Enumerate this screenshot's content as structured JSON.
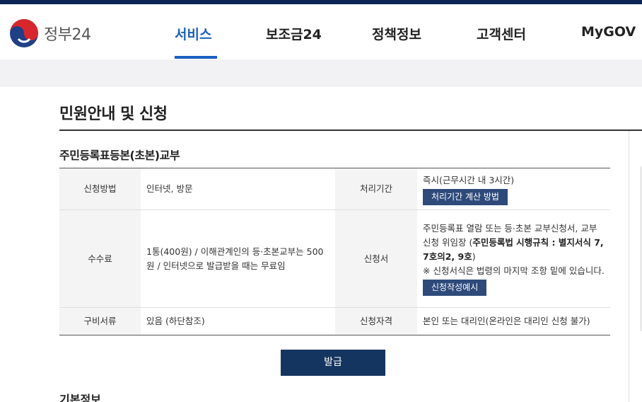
{
  "header": {
    "logo_text": "정부24",
    "nav": [
      "서비스",
      "보조금24",
      "정책정보",
      "고객센터",
      "MyGOV"
    ],
    "active_nav": "서비스"
  },
  "page": {
    "title": "민원안내 및 신청",
    "doc_title": "주민등록표등본(초본)교부",
    "section_next": "기본정보"
  },
  "table": {
    "apply_method_label": "신청방법",
    "apply_method_value": "인터넷, 방문",
    "processing_label": "처리기간",
    "processing_value": "즉시(근무시간 내 3시간)",
    "processing_button": "처리기간 계산 방법",
    "fee_label": "수수료",
    "fee_value": "1통(400원) / 이해관계인의 등·초본교부는 500원 / 인터넷으로 발급받을 때는 무료임",
    "form_label": "신청서",
    "form_value_1": "주민등록표 열람 또는 등·초본 교부신청서, 교부 신청 위임장 (",
    "form_value_bold": "주민등록법 시행규칙 : 별지서식 7, 7호의2, 9호",
    "form_value_2": ")",
    "form_note": "※ 신청서식은 법령의 마지막 조항 밑에 있습니다.",
    "form_button": "신청작성예시",
    "docs_label": "구비서류",
    "docs_value": "있음 (하단참조)",
    "eligibility_label": "신청자격",
    "eligibility_value": "본인 또는 대리인(온라인은 대리인 신청 불가)"
  },
  "issue_button": "발급",
  "colors": {
    "brand_navy": "#0b2454",
    "active_blue": "#1a5fc3",
    "button_navy": "#14355f",
    "small_button": "#2e4a7b"
  }
}
